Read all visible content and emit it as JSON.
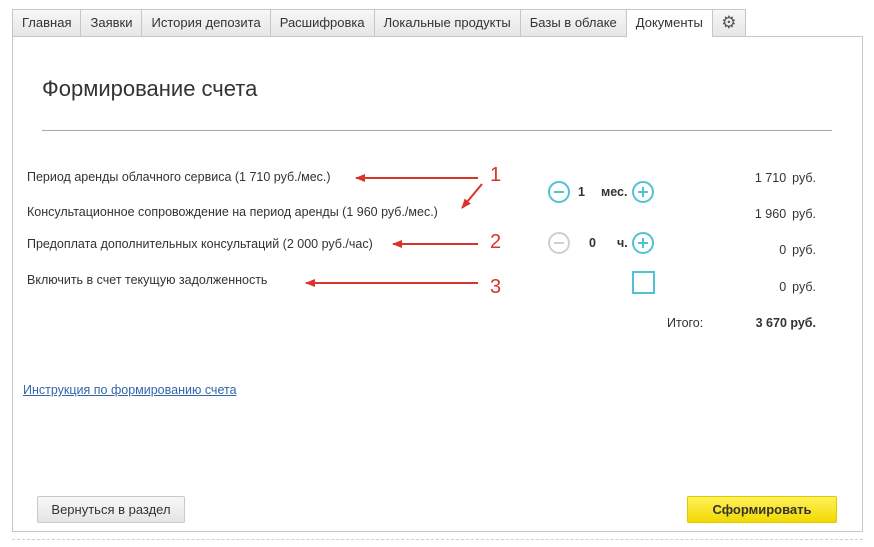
{
  "tabs": [
    {
      "label": "Главная"
    },
    {
      "label": "Заявки"
    },
    {
      "label": "История депозита"
    },
    {
      "label": "Расшифровка"
    },
    {
      "label": "Локальные продукты"
    },
    {
      "label": "Базы в облаке"
    },
    {
      "label": "Документы",
      "active": true
    }
  ],
  "gear_icon": "gear-icon",
  "page": {
    "title": "Формирование счета"
  },
  "rows": [
    {
      "label": "Период аренды облачного сервиса (1 710 руб./мес.)",
      "amount": "1 710",
      "currency": "руб."
    },
    {
      "label": "Консультационное сопровождение на период аренды (1 960 руб./мес.)",
      "amount": "1 960",
      "currency": "руб."
    },
    {
      "label": "Предоплата дополнительных консультаций (2 000 руб./час)",
      "amount": "0",
      "currency": "руб."
    },
    {
      "label": "Включить в счет текущую задолженность",
      "amount": "0",
      "currency": "руб."
    }
  ],
  "months_stepper": {
    "value": "1",
    "unit": "мес."
  },
  "hours_stepper": {
    "value": "0",
    "unit": "ч."
  },
  "total": {
    "label": "Итого:",
    "value": "3 670 руб."
  },
  "instruction_link": "Инструкция по формированию счета",
  "buttons": {
    "back": "Вернуться в раздел",
    "generate": "Сформировать"
  },
  "annotations": [
    "1",
    "2",
    "3"
  ],
  "colors": {
    "accent": "#4ec3d6",
    "annotation": "#d9342b",
    "link": "#3366aa",
    "primary_button": "#f2d900"
  }
}
